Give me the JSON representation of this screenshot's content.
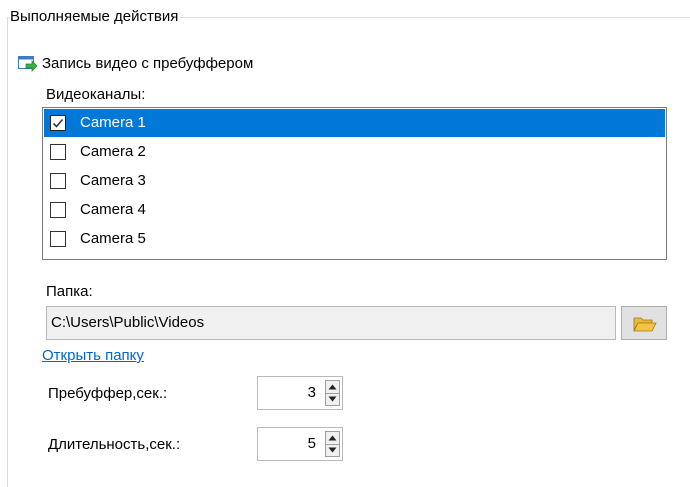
{
  "group": {
    "title": "Выполняемые действия"
  },
  "action": {
    "label": "Запись видео с пребуффером",
    "icon": "record-action-icon"
  },
  "channels": {
    "label": "Видеоканалы:",
    "items": [
      {
        "label": "Camera 1",
        "checked": true,
        "selected": true
      },
      {
        "label": "Camera 2",
        "checked": false,
        "selected": false
      },
      {
        "label": "Camera 3",
        "checked": false,
        "selected": false
      },
      {
        "label": "Camera 4",
        "checked": false,
        "selected": false
      },
      {
        "label": "Camera 5",
        "checked": false,
        "selected": false
      }
    ]
  },
  "folder": {
    "label": "Папка:",
    "value": "C:\\Users\\Public\\Videos",
    "browse_icon": "folder-open-icon",
    "open_link": "Открыть папку"
  },
  "prebuffer": {
    "label": "Пребуффер,сек.:",
    "value": "3"
  },
  "duration": {
    "label": "Длительность,сек.:",
    "value": "5"
  },
  "colors": {
    "selection": "#0078d7",
    "link": "#0066cc",
    "folder": "#f5c542"
  }
}
